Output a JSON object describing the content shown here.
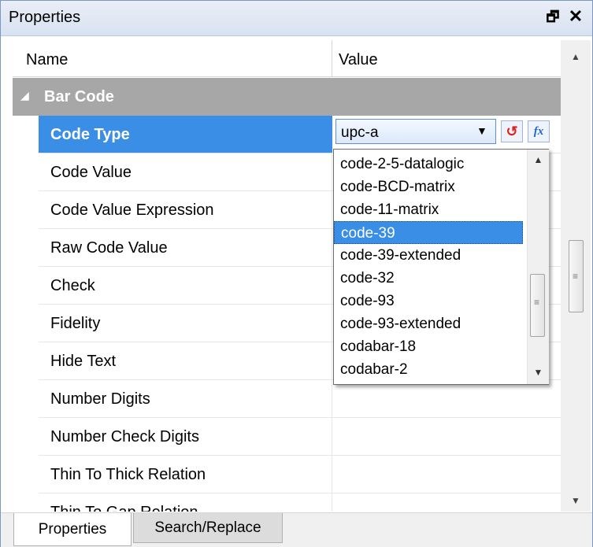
{
  "window": {
    "title": "Properties",
    "pin_glyph": "🗗",
    "close_glyph": "✕"
  },
  "header": {
    "name": "Name",
    "value": "Value"
  },
  "category": {
    "label": "Bar Code",
    "expander_glyph": "◢"
  },
  "properties": [
    {
      "name": "Code Type",
      "value": "upc-a",
      "selected": true
    },
    {
      "name": "Code Value"
    },
    {
      "name": "Code Value Expression"
    },
    {
      "name": "Raw Code Value"
    },
    {
      "name": "Check"
    },
    {
      "name": "Fidelity"
    },
    {
      "name": "Hide Text"
    },
    {
      "name": "Number Digits"
    },
    {
      "name": "Number Check Digits"
    },
    {
      "name": "Thin To Thick Relation"
    },
    {
      "name": "Thin To Gap Relation"
    }
  ],
  "editor": {
    "reset_glyph": "↺",
    "fx_label": "fx",
    "arrow_glyph": "▼"
  },
  "dropdown": {
    "items": [
      "code-2-5-datalogic",
      "code-BCD-matrix",
      "code-11-matrix",
      "code-39",
      "code-39-extended",
      "code-32",
      "code-93",
      "code-93-extended",
      "codabar-18",
      "codabar-2"
    ],
    "selected": "code-39",
    "up_glyph": "▲",
    "down_glyph": "▼",
    "grip_glyph": "≡"
  },
  "scrollbar": {
    "up_glyph": "▲",
    "down_glyph": "▼",
    "grip_glyph": "≡"
  },
  "tabs": [
    {
      "label": "Properties",
      "active": true
    },
    {
      "label": "Search/Replace",
      "active": false
    }
  ],
  "colors": {
    "selection": "#3a8ee6",
    "category_bg": "#a7a7a7",
    "reset_icon": "#dd2222",
    "fx_icon": "#2266cc"
  }
}
